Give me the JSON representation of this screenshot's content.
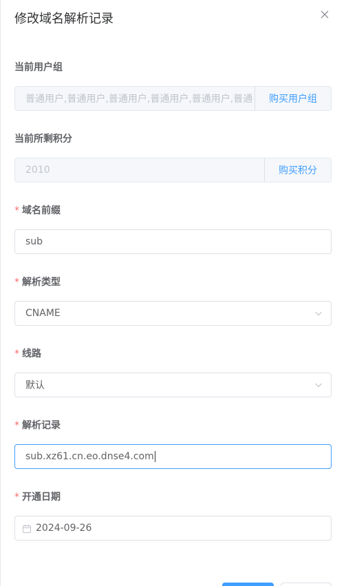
{
  "dialog": {
    "title": "修改域名解析记录",
    "close_icon": "close-icon"
  },
  "fields": {
    "user_group": {
      "label": "当前用户组",
      "value": "普通用户,普通用户,普通用户,普通用户,普通用户,普通",
      "action": "购买用户组"
    },
    "points": {
      "label": "当前所剩积分",
      "value": "2010",
      "action": "购买积分"
    },
    "prefix": {
      "required_mark": "*",
      "label": "域名前缀",
      "value": "sub"
    },
    "record_type": {
      "required_mark": "*",
      "label": "解析类型",
      "value": "CNAME"
    },
    "line": {
      "required_mark": "*",
      "label": "线路",
      "value": "默认"
    },
    "record": {
      "required_mark": "*",
      "label": "解析记录",
      "value": "sub.xz61.cn.eo.dnse4.com"
    },
    "open_date": {
      "required_mark": "*",
      "label": "开通日期",
      "value": "2024-09-26"
    }
  },
  "colors": {
    "primary": "#409eff",
    "required": "#f56c6c",
    "border": "#dcdfe6",
    "disabled_bg": "#f5f7fa"
  }
}
